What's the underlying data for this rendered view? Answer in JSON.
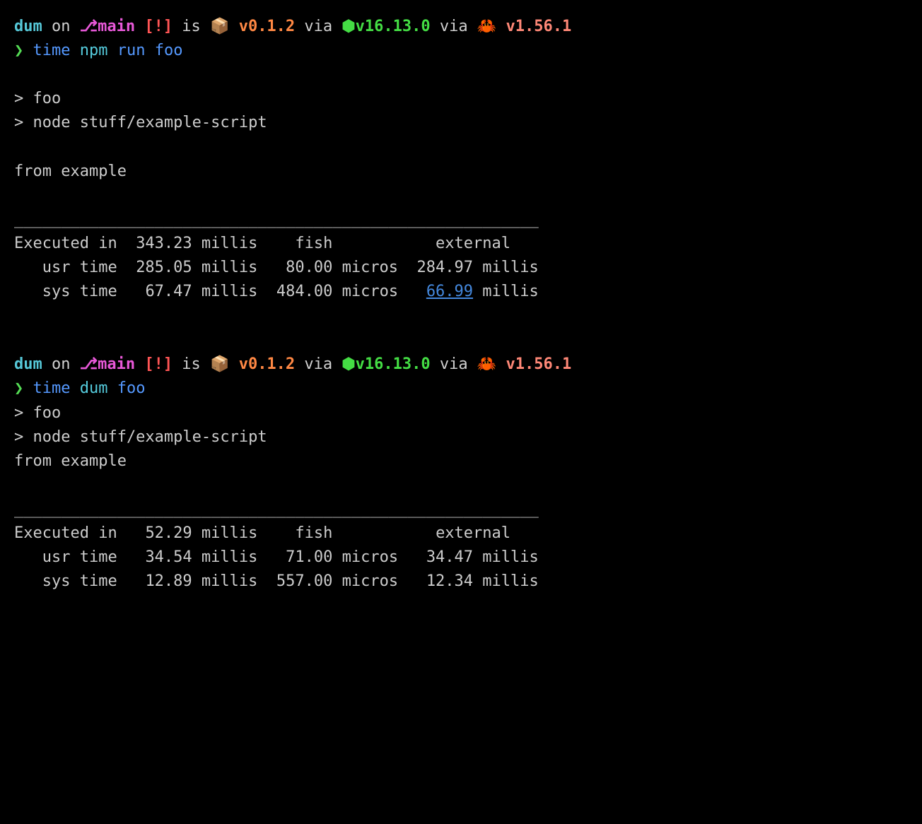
{
  "prompt1": {
    "dir": "dum",
    "on": " on ",
    "branch_icon": "⎇",
    "branch": "main",
    "status": " [!]",
    "is": " is ",
    "pkg_icon": "📦",
    "pkg_version": " v0.1.2",
    "via1": " via ",
    "node_icon": "⬢",
    "node_version": "v16.13.0",
    "via2": " via ",
    "rust_icon": "🦀",
    "rust_version": " v1.56.1",
    "prompt_char": "❯ ",
    "cmd_time": "time",
    "cmd_npm": " npm",
    "cmd_run": " run",
    "cmd_foo": " foo"
  },
  "output1": {
    "line1": "> foo",
    "line2": "> node stuff/example-script",
    "line3": "from example",
    "divider": "________________________________________________________",
    "exec_label": "Executed in  ",
    "exec_val": "343.23 millis",
    "fish_label": "    fish           ",
    "ext_label": "external",
    "usr_label": "   usr time  ",
    "usr_val": "285.05 millis",
    "usr_fish": "   80.00 micros  ",
    "usr_ext": "284.97 millis",
    "sys_label": "   sys time   ",
    "sys_val": "67.47 millis",
    "sys_fish": "  484.00 micros   ",
    "sys_ext_link": "66.99",
    "sys_ext_unit": " millis"
  },
  "prompt2": {
    "dir": "dum",
    "on": " on ",
    "branch_icon": "⎇",
    "branch": "main",
    "status": " [!]",
    "is": " is ",
    "pkg_icon": "📦",
    "pkg_version": " v0.1.2",
    "via1": " via ",
    "node_icon": "⬢",
    "node_version": "v16.13.0",
    "via2": " via ",
    "rust_icon": "🦀",
    "rust_version": " v1.56.1",
    "prompt_char": "❯ ",
    "cmd_time": "time",
    "cmd_dum": " dum",
    "cmd_foo": " foo"
  },
  "output2": {
    "line1": "> foo",
    "line2": "> node stuff/example-script",
    "line3": "from example",
    "divider": "________________________________________________________",
    "exec_label": "Executed in   ",
    "exec_val": "52.29 millis",
    "fish_label": "    fish           ",
    "ext_label": "external",
    "usr_label": "   usr time   ",
    "usr_val": "34.54 millis",
    "usr_fish": "   71.00 micros   ",
    "usr_ext": "34.47 millis",
    "sys_label": "   sys time   ",
    "sys_val": "12.89 millis",
    "sys_fish": "  557.00 micros   ",
    "sys_ext": "12.34 millis"
  }
}
